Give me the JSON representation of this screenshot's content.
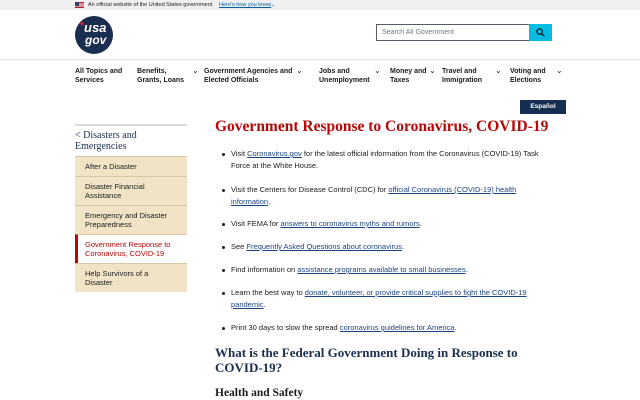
{
  "banner": {
    "text": "An official website of the United States government",
    "how_link": "Here's how you know"
  },
  "header": {
    "logo_line1": "usa",
    "logo_line2": "gov",
    "search_placeholder": "Search All Government"
  },
  "nav": {
    "items": [
      {
        "label_line1": "All Topics and",
        "label_line2": "Services"
      },
      {
        "label_line1": "Benefits,",
        "label_line2": "Grants, Loans"
      },
      {
        "label_line1": "Government Agencies and",
        "label_line2": "Elected Officials"
      },
      {
        "label_line1": "Jobs and",
        "label_line2": "Unemployment"
      },
      {
        "label_line1": "Money and",
        "label_line2": "Taxes"
      },
      {
        "label_line1": "Travel and",
        "label_line2": "Immigration"
      },
      {
        "label_line1": "Voting and",
        "label_line2": "Elections"
      }
    ]
  },
  "espanol": "Español",
  "sidebar": {
    "heading_line1": "< Disasters and",
    "heading_line2": "Emergencies",
    "items": [
      {
        "line1": "After a Disaster",
        "line2": ""
      },
      {
        "line1": "Disaster Financial",
        "line2": "Assistance"
      },
      {
        "line1": "Emergency and Disaster",
        "line2": "Preparedness"
      },
      {
        "line1": "Government Response to",
        "line2": "Coronavirus, COVID-19"
      },
      {
        "line1": "Help Survivors of a Disaster",
        "line2": ""
      }
    ]
  },
  "main": {
    "title": "Government Response to Coronavirus, COVID-19",
    "bullets": [
      {
        "pre": "Visit ",
        "link": "Coronavirus.gov",
        "post": " for the latest official information from the Coronavirus (COVID-19) Task Force at the White House."
      },
      {
        "pre": "Visit the Centers for Disease Control (CDC) for ",
        "link": "official Coronavirus (COVID-19) health information",
        "post": "."
      },
      {
        "pre": "Visit FEMA for ",
        "link": "answers to coronavirus myths and rumors",
        "post": "."
      },
      {
        "pre": "See ",
        "link": "Frequently Asked Questions about coronavirus",
        "post": "."
      },
      {
        "pre": "Find information on ",
        "link": "assistance programs available to small businesses",
        "post": "."
      },
      {
        "pre": "Learn the best way to ",
        "link": "donate, volunteer, or provide critical supplies to fight the COVID-19 pandemic",
        "post": "."
      },
      {
        "pre": "Print 30 days to slow the spread ",
        "link": "coronavirus guidelines for America",
        "post": "."
      }
    ],
    "subheading": "What is the Federal Government Doing in Response to COVID-19?",
    "section_heading": "Health and Safety"
  }
}
